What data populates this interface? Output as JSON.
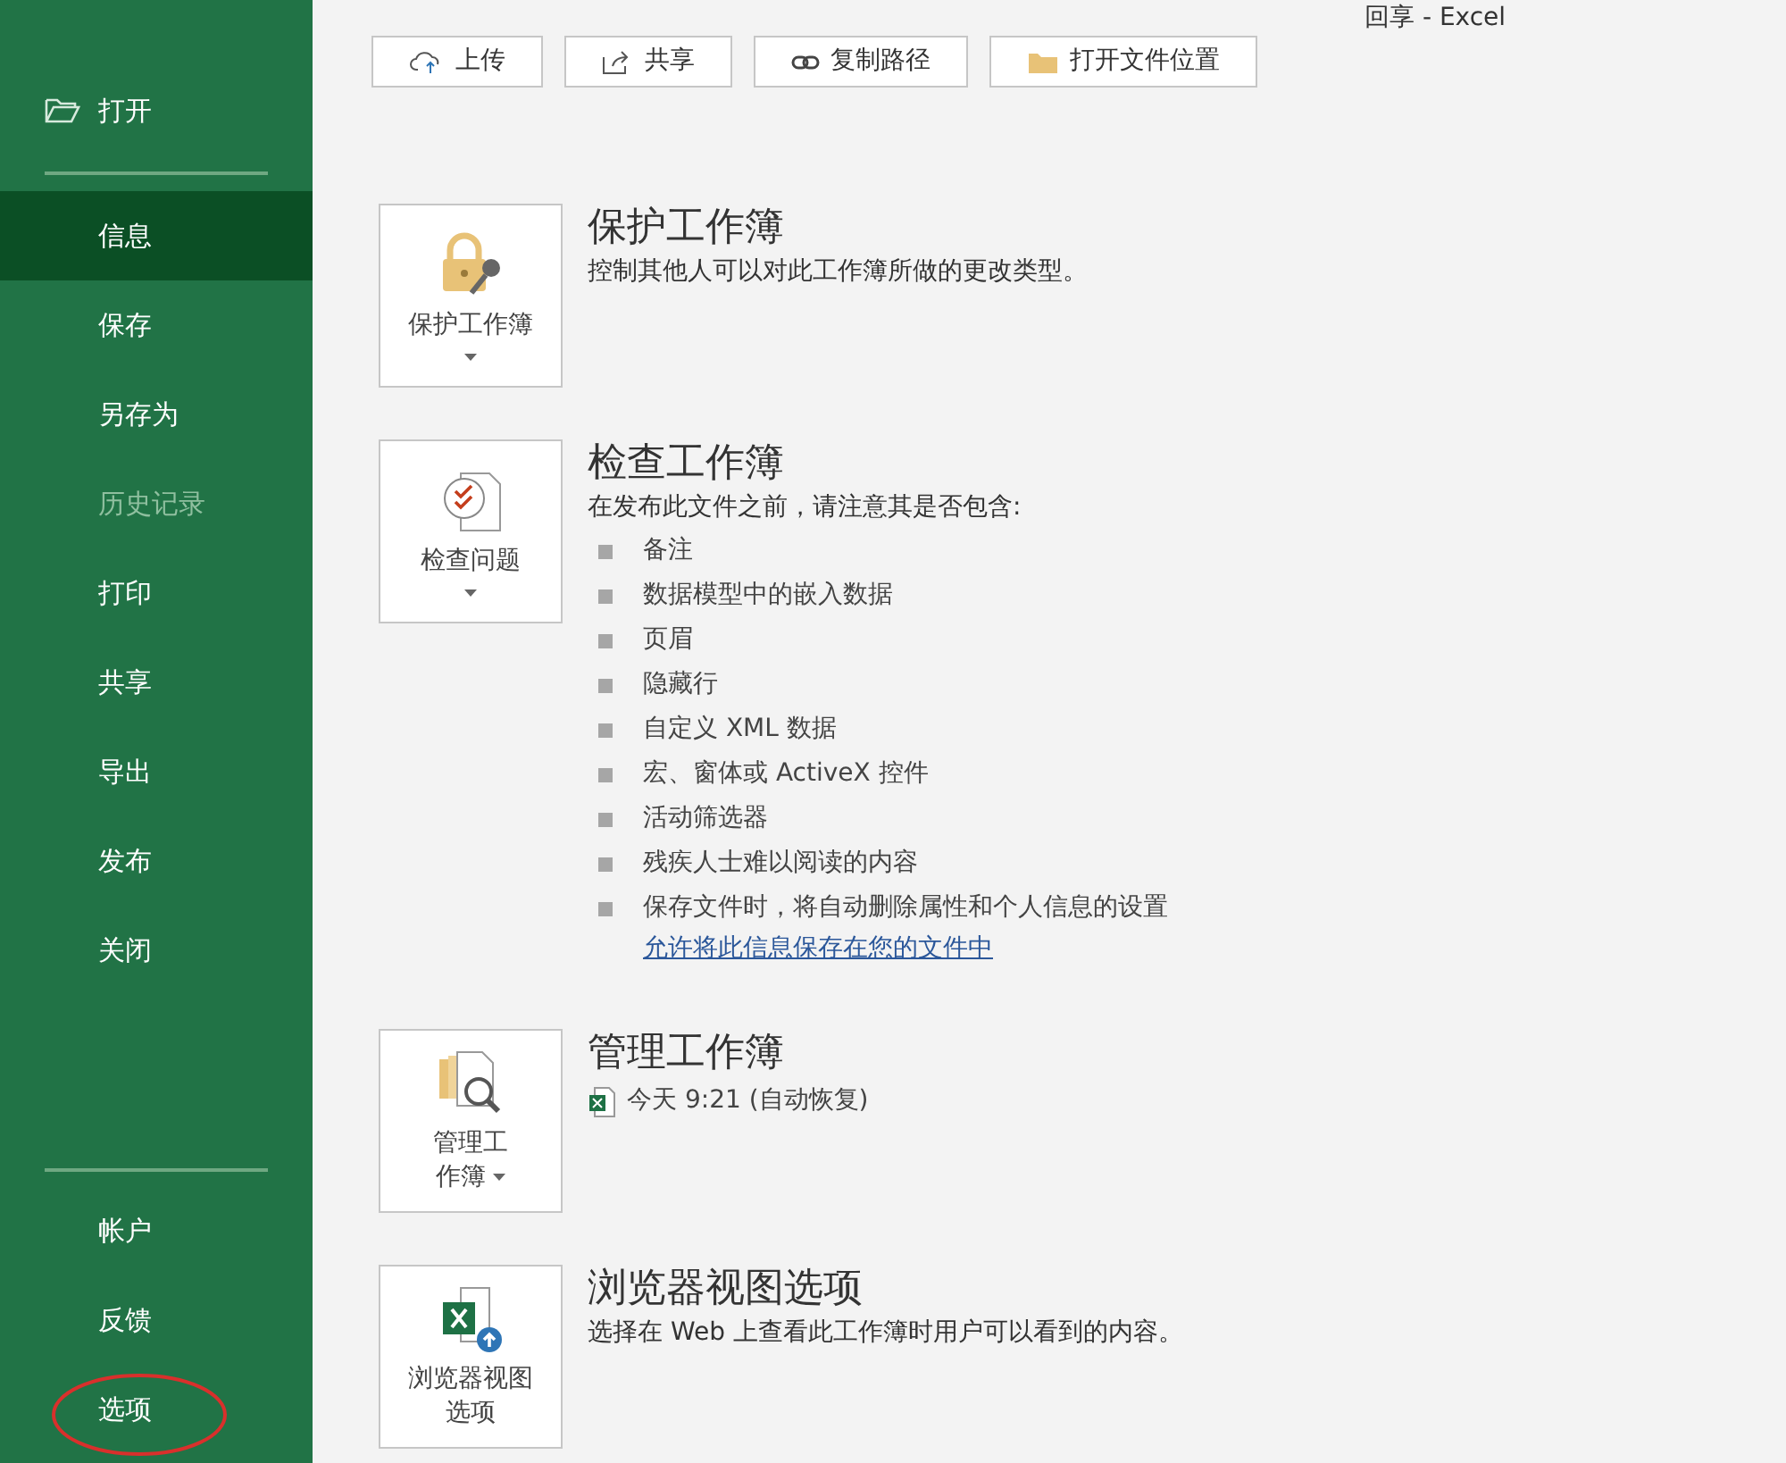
{
  "window": {
    "title": "回享  -  Excel"
  },
  "sidebar": {
    "top_items": [
      {
        "label": "打开"
      }
    ],
    "items": [
      {
        "label": "信息",
        "selected": true,
        "disabled": false
      },
      {
        "label": "保存",
        "selected": false,
        "disabled": false
      },
      {
        "label": "另存为",
        "selected": false,
        "disabled": false
      },
      {
        "label": "历史记录",
        "selected": false,
        "disabled": true
      },
      {
        "label": "打印",
        "selected": false,
        "disabled": false
      },
      {
        "label": "共享",
        "selected": false,
        "disabled": false
      },
      {
        "label": "导出",
        "selected": false,
        "disabled": false
      },
      {
        "label": "发布",
        "selected": false,
        "disabled": false
      },
      {
        "label": "关闭",
        "selected": false,
        "disabled": false
      }
    ],
    "bottom_items": [
      {
        "label": "帐户",
        "circled": false
      },
      {
        "label": "反馈",
        "circled": false
      },
      {
        "label": "选项",
        "circled": true
      }
    ]
  },
  "toolbar": [
    {
      "label": "上传",
      "kind": "upload"
    },
    {
      "label": "共享",
      "kind": "share"
    },
    {
      "label": "复制路径",
      "kind": "link"
    },
    {
      "label": "打开文件位置",
      "kind": "folder"
    }
  ],
  "sections": [
    {
      "kind": "protect",
      "tile_lines": [
        "保护工作簿"
      ],
      "title": "保护工作簿",
      "description": "控制其他人可以对此工作簿所做的更改类型。"
    },
    {
      "kind": "inspect",
      "tile_lines": [
        "检查问题"
      ],
      "title": "检查工作簿",
      "description": "在发布此文件之前，请注意其是否包含:",
      "bullets": [
        "备注",
        "数据模型中的嵌入数据",
        "页眉",
        "隐藏行",
        "自定义 XML 数据",
        "宏、窗体或 ActiveX 控件",
        "活动筛选器",
        "残疾人士难以阅读的内容",
        "保存文件时，将自动删除属性和个人信息的设置"
      ],
      "link": "允许将此信息保存在您的文件中"
    },
    {
      "kind": "manage",
      "tile_lines": [
        "管理工",
        "作簿"
      ],
      "title": "管理工作簿",
      "version": "今天 9:21 (自动恢复)"
    },
    {
      "kind": "browser",
      "tile_lines": [
        "浏览器视图",
        "选项"
      ],
      "title": "浏览器视图选项",
      "description": "选择在 Web 上查看此工作簿时用户可以看到的内容。"
    }
  ]
}
